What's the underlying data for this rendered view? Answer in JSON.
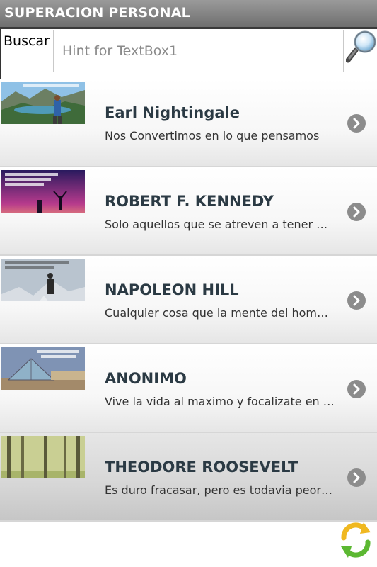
{
  "app": {
    "title": "SUPERACION PERSONAL"
  },
  "search": {
    "label": "Buscar",
    "placeholder": "Hint for TextBox1",
    "button_icon": "magnifier-icon"
  },
  "items": [
    {
      "title": "Earl Nightingale",
      "subtitle": "Nos Convertimos en lo que pensamos",
      "thumbnail_icon": "quote-image-mountain-lake",
      "action_icon": "chevron-right-icon"
    },
    {
      "title": "ROBERT F. KENNEDY",
      "subtitle": "Solo aquellos que se atreven a tener grandes fracasos",
      "thumbnail_icon": "quote-image-purple-sunset",
      "action_icon": "chevron-right-icon"
    },
    {
      "title": "NAPOLEON HILL",
      "subtitle": "Cualquier cosa que la mente del hombre pueda concebir",
      "thumbnail_icon": "quote-image-climber-peak",
      "action_icon": "chevron-right-icon"
    },
    {
      "title": "ANONIMO",
      "subtitle": "Vive la vida al maximo y focalizate en lo positivo",
      "thumbnail_icon": "quote-image-louvre-pyramid",
      "action_icon": "chevron-right-icon"
    },
    {
      "title": "THEODORE ROOSEVELT",
      "subtitle": "Es duro fracasar, pero es todavia peor no haber intentado",
      "thumbnail_icon": "quote-image-forest",
      "action_icon": "chevron-right-icon",
      "selected": true
    }
  ],
  "footer": {
    "refresh_icon": "refresh-icon"
  }
}
